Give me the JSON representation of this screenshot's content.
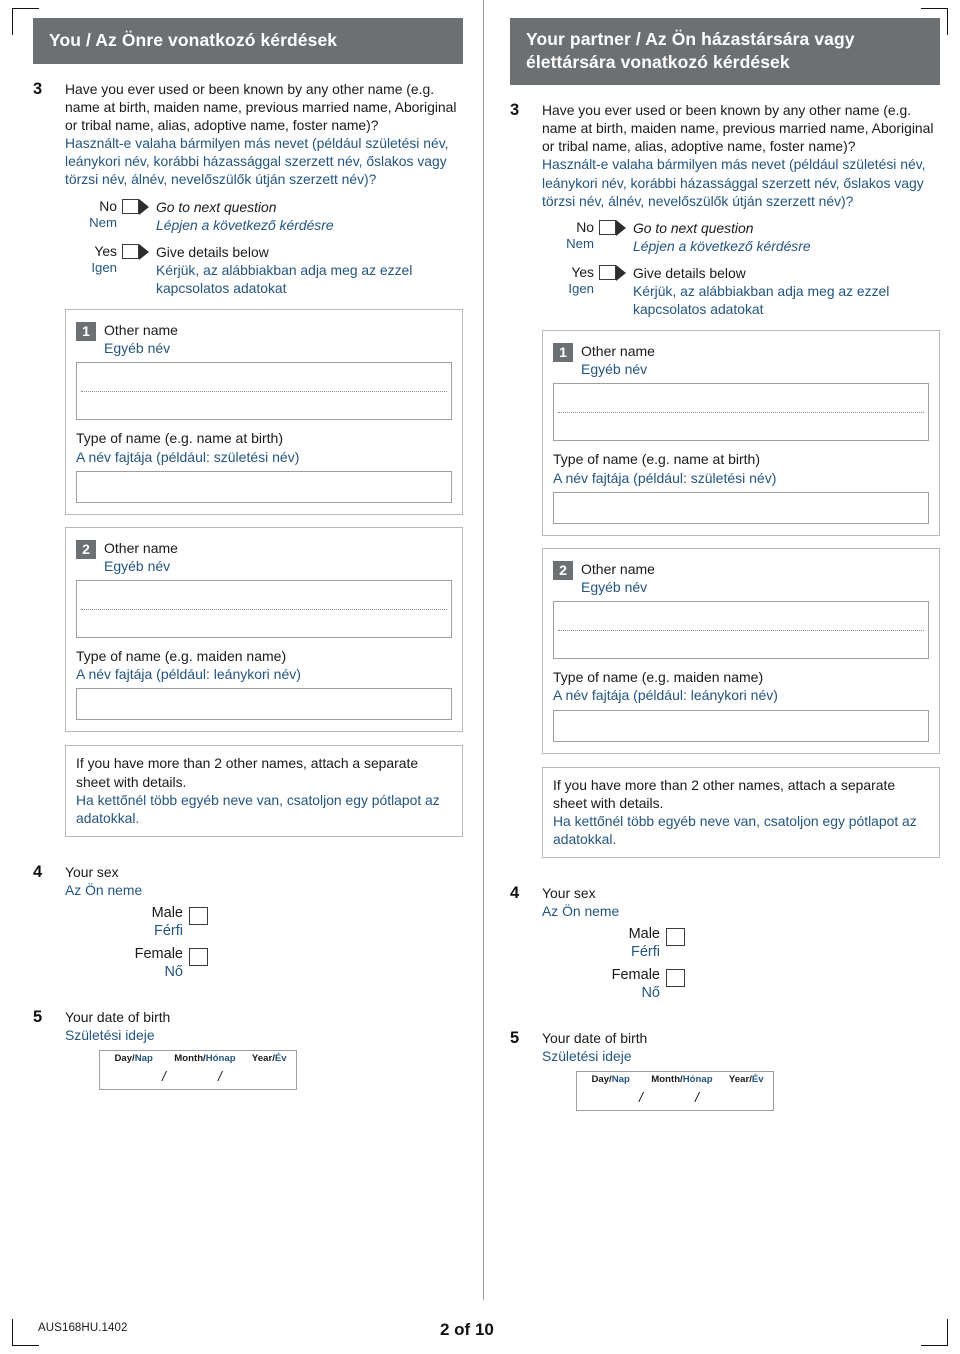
{
  "page": {
    "form_code": "AUS168HU.1402",
    "page_number": "2 of 10",
    "accent_gray": "#6d7073",
    "hungarian_blue": "#24557f"
  },
  "columns": [
    {
      "header": "You / Az Önre vonatkozó kérdések",
      "questions": {
        "q3": {
          "number": "3",
          "en": "Have you ever used or been known by any other name (e.g. name at birth, maiden name, previous married name, Aboriginal or tribal name, alias, adoptive name, foster name)?",
          "hu": "Használt-e valaha bármilyen más nevet (például születési név, leánykori név, korábbi házassággal szerzett név, őslakos vagy törzsi név, álnév, nevelőszülők útján szerzett név)?",
          "answers": [
            {
              "label_en": "No",
              "label_hu": "Nem",
              "action_en": "Go to next question",
              "action_hu": "Lépjen a következő kérdésre"
            },
            {
              "label_en": "Yes",
              "label_hu": "Igen",
              "action_en": "Give details below",
              "action_hu": "Kérjük, az alábbiakban adja meg az ezzel kapcsolatos adatokat"
            }
          ],
          "entries": [
            {
              "badge": "1",
              "name_en": "Other name",
              "name_hu": "Egyéb név",
              "type_en": "Type of name (e.g. name at birth)",
              "type_hu": "A név fajtája (például: születési név)"
            },
            {
              "badge": "2",
              "name_en": "Other name",
              "name_hu": "Egyéb név",
              "type_en": "Type of name (e.g. maiden name)",
              "type_hu": "A név fajtája (például: leánykori név)"
            }
          ],
          "note_en": "If you have more than 2 other names, attach a separate sheet with details.",
          "note_hu": "Ha kettőnél több egyéb neve van, csatoljon egy pótlapot az adatokkal."
        },
        "q4": {
          "number": "4",
          "en": "Your sex",
          "hu": "Az Ön neme",
          "options": [
            {
              "en": "Male",
              "hu": "Férfi"
            },
            {
              "en": "Female",
              "hu": "Nő"
            }
          ]
        },
        "q5": {
          "number": "5",
          "en": "Your date of birth",
          "hu": "Születési ideje",
          "day_en": "Day/",
          "day_hu": "Nap",
          "month_en": "Month/",
          "month_hu": "Hónap",
          "year_en": "Year/",
          "year_hu": "Év",
          "separator": "/"
        }
      }
    },
    {
      "header": "Your partner / Az Ön házastársára vagy élettársára vonatkozó kérdések",
      "questions": {
        "q3": {
          "number": "3",
          "en": "Have you ever used or been known by any other name (e.g. name at birth, maiden name, previous married name, Aboriginal or tribal name, alias, adoptive name, foster name)?",
          "hu": "Használt-e valaha bármilyen más nevet (például születési név, leánykori név, korábbi házassággal szerzett név, őslakos vagy törzsi név, álnév, nevelőszülők útján szerzett név)?",
          "answers": [
            {
              "label_en": "No",
              "label_hu": "Nem",
              "action_en": "Go to next question",
              "action_hu": "Lépjen a következő kérdésre"
            },
            {
              "label_en": "Yes",
              "label_hu": "Igen",
              "action_en": "Give details below",
              "action_hu": "Kérjük, az alábbiakban adja meg az ezzel kapcsolatos adatokat"
            }
          ],
          "entries": [
            {
              "badge": "1",
              "name_en": "Other name",
              "name_hu": "Egyéb név",
              "type_en": "Type of name (e.g. name at birth)",
              "type_hu": "A név fajtája (például: születési név)"
            },
            {
              "badge": "2",
              "name_en": "Other name",
              "name_hu": "Egyéb név",
              "type_en": "Type of name (e.g. maiden name)",
              "type_hu": "A név fajtája (például: leánykori név)"
            }
          ],
          "note_en": "If you have more than 2 other names, attach a separate sheet with details.",
          "note_hu": "Ha kettőnél több egyéb neve van, csatoljon egy pótlapot az adatokkal."
        },
        "q4": {
          "number": "4",
          "en": "Your sex",
          "hu": "Az Ön neme",
          "options": [
            {
              "en": "Male",
              "hu": "Férfi"
            },
            {
              "en": "Female",
              "hu": "Nő"
            }
          ]
        },
        "q5": {
          "number": "5",
          "en": "Your date of birth",
          "hu": "Születési ideje",
          "day_en": "Day/",
          "day_hu": "Nap",
          "month_en": "Month/",
          "month_hu": "Hónap",
          "year_en": "Year/",
          "year_hu": "Év",
          "separator": "/"
        }
      }
    }
  ]
}
